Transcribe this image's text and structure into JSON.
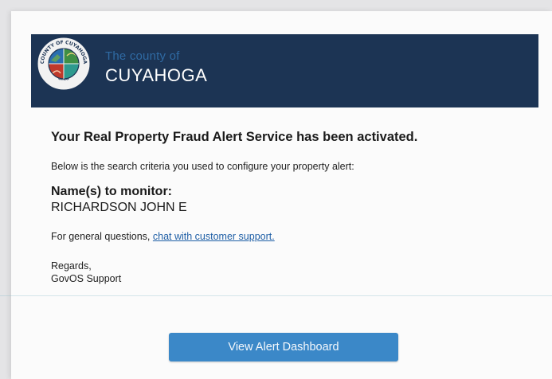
{
  "header": {
    "seal_text": "COUNTY OF CUYAHOGA",
    "seal_state": "OHIO",
    "county_prefix": "The county of",
    "county_name": "CUYAHOGA"
  },
  "body": {
    "headline": "Your Real Property Fraud Alert Service has been activated.",
    "intro": "Below is the search criteria you used to configure your property alert:",
    "monitor_label": "Name(s) to monitor:",
    "monitor_value": "RICHARDSON JOHN E",
    "questions_prefix": "For general questions,",
    "support_link": "chat with customer support.",
    "regards": "Regards,",
    "signature": "GovOS Support"
  },
  "cta": {
    "label": "View Alert Dashboard"
  },
  "colors": {
    "banner": "#1c3454",
    "link": "#1f5fa6",
    "button": "#3b88c8"
  }
}
